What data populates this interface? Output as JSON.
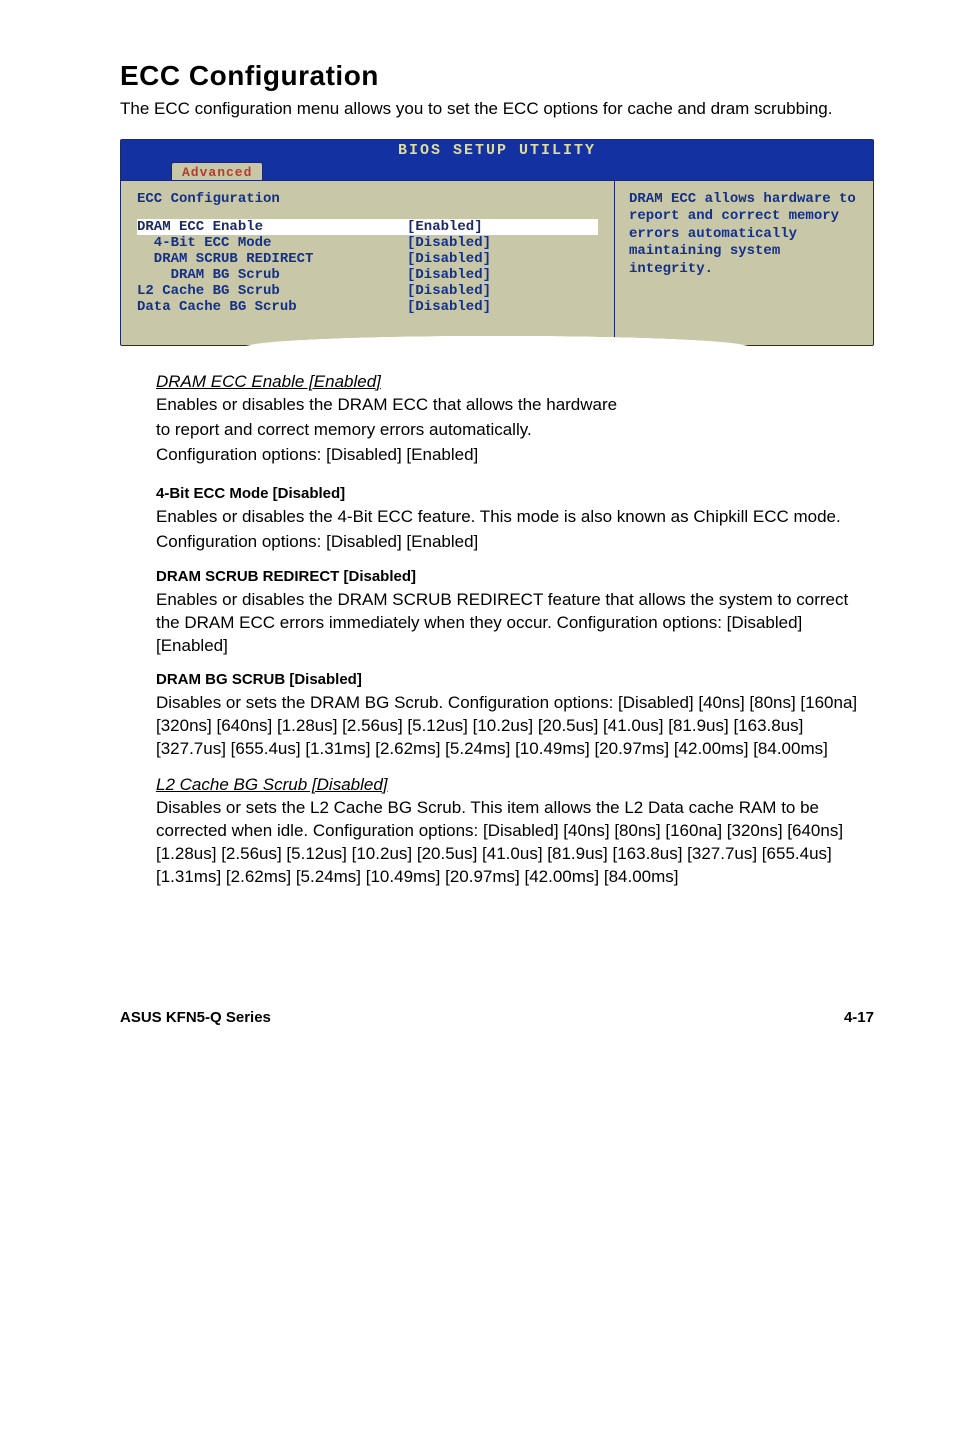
{
  "section": {
    "title": "ECC Configuration",
    "lead": "The ECC configuration menu allows you to set the ECC options for cache and dram scrubbing."
  },
  "bios": {
    "titlebar": "BIOS SETUP UTILITY",
    "tab": "Advanced",
    "heading": "ECC Configuration",
    "rows": [
      {
        "label": "DRAM ECC Enable",
        "value": "[Enabled]",
        "indent": 0,
        "selected": true
      },
      {
        "label": "4-Bit ECC Mode",
        "value": "[Disabled]",
        "indent": 1
      },
      {
        "label": "DRAM SCRUB REDIRECT",
        "value": "[Disabled]",
        "indent": 1
      },
      {
        "label": "DRAM BG Scrub",
        "value": "[Disabled]",
        "indent": 2
      },
      {
        "label": "L2 Cache BG Scrub",
        "value": "[Disabled]",
        "indent": 0
      },
      {
        "label": "Data Cache BG Scrub",
        "value": "[Disabled]",
        "indent": 0
      }
    ],
    "help": "DRAM ECC allows hardware to report and correct memory errors automatically maintaining system integrity."
  },
  "items": {
    "dram_ecc_enable": {
      "title": "DRAM ECC Enable [Enabled]",
      "line1": "Enables or disables the DRAM ECC that allows the hardware",
      "line2": "to report and correct memory errors automatically.",
      "line3": "Configuration options: [Disabled] [Enabled]"
    },
    "four_bit": {
      "title": "4-Bit ECC Mode [Disabled]",
      "p1": "Enables or disables the 4-Bit ECC feature. This mode is also known as Chipkill ECC mode.",
      "p2": "Configuration options: [Disabled] [Enabled]"
    },
    "scrub_redirect": {
      "title": "DRAM SCRUB REDIRECT [Disabled]",
      "p1": "Enables or disables the DRAM SCRUB REDIRECT feature that allows the system to correct the DRAM ECC errors immediately when they occur. Configuration options: [Disabled] [Enabled]"
    },
    "bg_scrub": {
      "title": "DRAM BG SCRUB [Disabled]",
      "p1": "Disables or sets the DRAM BG Scrub. Configuration options: [Disabled] [40ns] [80ns] [160na] [320ns] [640ns] [1.28us] [2.56us] [5.12us] [10.2us] [20.5us] [41.0us] [81.9us] [163.8us] [327.7us] [655.4us] [1.31ms] [2.62ms] [5.24ms] [10.49ms] [20.97ms] [42.00ms] [84.00ms]"
    },
    "l2_scrub": {
      "title": "L2 Cache BG Scrub [Disabled]",
      "p1": "Disables or sets the L2 Cache BG Scrub. This item allows the L2 Data cache RAM to be corrected when idle. Configuration options: [Disabled] [40ns] [80ns] [160na] [320ns] [640ns] [1.28us] [2.56us] [5.12us] [10.2us] [20.5us] [41.0us] [81.9us] [163.8us] [327.7us] [655.4us] [1.31ms] [2.62ms] [5.24ms] [10.49ms] [20.97ms] [42.00ms] [84.00ms]"
    }
  },
  "footer": {
    "left": "ASUS KFN5-Q Series",
    "right": "4-17"
  }
}
